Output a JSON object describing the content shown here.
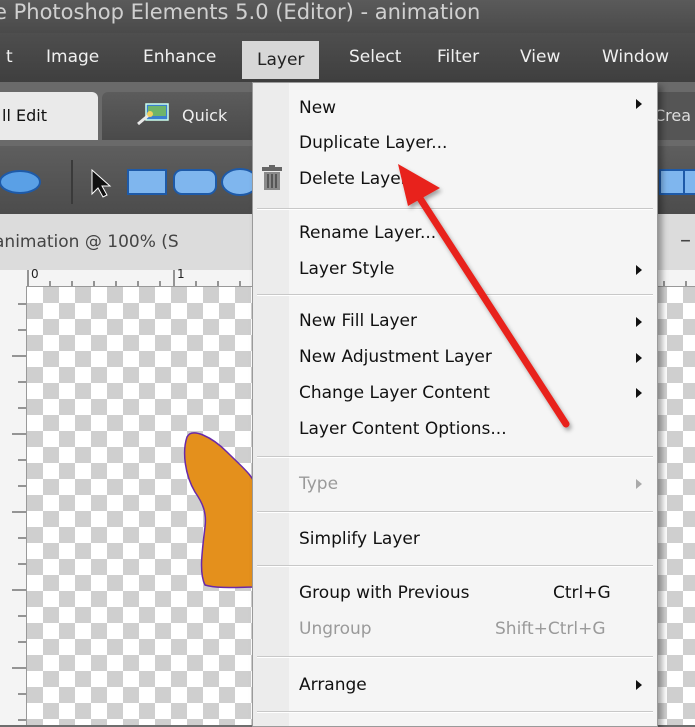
{
  "window": {
    "title": "e Photoshop Elements 5.0 (Editor) - animation"
  },
  "menubar": {
    "items": [
      {
        "label": "t"
      },
      {
        "label": "Image"
      },
      {
        "label": "Enhance"
      },
      {
        "label": "Layer"
      },
      {
        "label": "Select"
      },
      {
        "label": "Filter"
      },
      {
        "label": "View"
      },
      {
        "label": "Window"
      }
    ]
  },
  "tabs": {
    "full_edit": "ll Edit",
    "quick": "Quick",
    "create": "Crea"
  },
  "document": {
    "title": "animation @ 100% (S",
    "min_glyph": "–"
  },
  "ruler": {
    "ticks": [
      "0",
      "1"
    ]
  },
  "layer_menu": {
    "items": [
      {
        "label": "New",
        "shortcut": "",
        "submenu": true,
        "disabled": false
      },
      {
        "label": "Duplicate Layer...",
        "shortcut": "",
        "submenu": false,
        "disabled": false
      },
      {
        "label": "Delete Layer",
        "shortcut": "",
        "submenu": false,
        "disabled": false
      },
      {
        "label": "Rename Layer...",
        "shortcut": "",
        "submenu": false,
        "disabled": false
      },
      {
        "label": "Layer Style",
        "shortcut": "",
        "submenu": true,
        "disabled": false
      },
      {
        "label": "New Fill Layer",
        "shortcut": "",
        "submenu": true,
        "disabled": false
      },
      {
        "label": "New Adjustment Layer",
        "shortcut": "",
        "submenu": true,
        "disabled": false
      },
      {
        "label": "Change Layer Content",
        "shortcut": "",
        "submenu": true,
        "disabled": false
      },
      {
        "label": "Layer Content Options...",
        "shortcut": "",
        "submenu": false,
        "disabled": false
      },
      {
        "label": "Type",
        "shortcut": "",
        "submenu": true,
        "disabled": true
      },
      {
        "label": "Simplify Layer",
        "shortcut": "",
        "submenu": false,
        "disabled": false
      },
      {
        "label": "Group with Previous",
        "shortcut": "Ctrl+G",
        "submenu": false,
        "disabled": false
      },
      {
        "label": "Ungroup",
        "shortcut": "Shift+Ctrl+G",
        "submenu": false,
        "disabled": true
      },
      {
        "label": "Arrange",
        "shortcut": "",
        "submenu": true,
        "disabled": false
      }
    ]
  },
  "colors": {
    "shape_fill": "#e4901c",
    "arrow": "#e8201a",
    "menu_active_bg": "#d7d7d7"
  },
  "icons": [
    "trash-icon",
    "lasso-icon",
    "move-arrow-icon",
    "rectangle-icon",
    "rounded-rectangle-icon",
    "ellipse-icon",
    "quick-fix-icon",
    "red-pointer-arrow"
  ]
}
